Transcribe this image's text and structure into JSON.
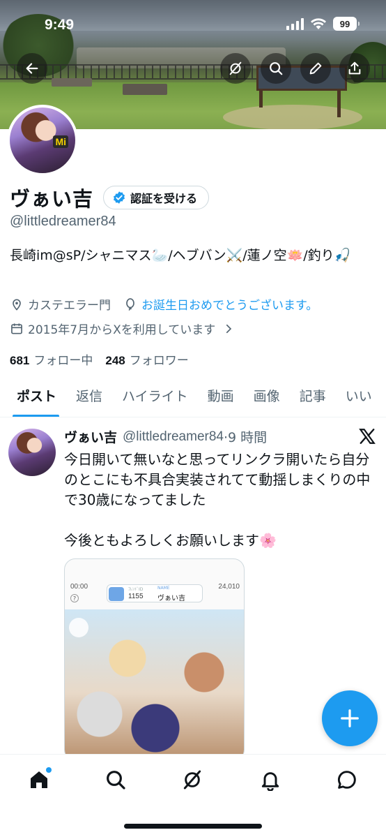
{
  "status_bar": {
    "time": "9:49",
    "battery": "99"
  },
  "profile": {
    "display_name": "ヴぁい吉",
    "verify_button": "認証を受ける",
    "handle": "@littledreamer84",
    "bio": "長崎im@sP/シャニマス🦢/ヘブバン⚔️/蓮ノ空🪷/釣り🎣",
    "location": "カステエラー門",
    "birthday_link": "お誕生日おめでとうございます。",
    "joined": "2015年7月からXを利用しています",
    "following_count": "681",
    "following_label": "フォロー中",
    "followers_count": "248",
    "followers_label": "フォロワー"
  },
  "tabs": [
    "ポスト",
    "返信",
    "ハイライト",
    "動画",
    "画像",
    "記事",
    "いい"
  ],
  "active_tab": "ポスト",
  "post": {
    "name": "ヴぁい吉",
    "handle": "@littledreamer84",
    "time": "·9 時間",
    "lines": [
      "今日開いて無いなと思ってリンクラ開いたら自分のとこにも不具合実装されてて動揺しまくりの中で30歳になってました",
      "今後ともよろしくお願いします🌸"
    ],
    "media": {
      "time": "00:00",
      "player_label": "ﾌﾚﾝﾄﾞID",
      "player_id": "1155",
      "name_label": "NAME",
      "player_name": "ヴぁい吉",
      "coins": "24,010"
    }
  },
  "colors": {
    "accent": "#1d9bf0",
    "text": "#0f1419",
    "muted": "#536471"
  }
}
